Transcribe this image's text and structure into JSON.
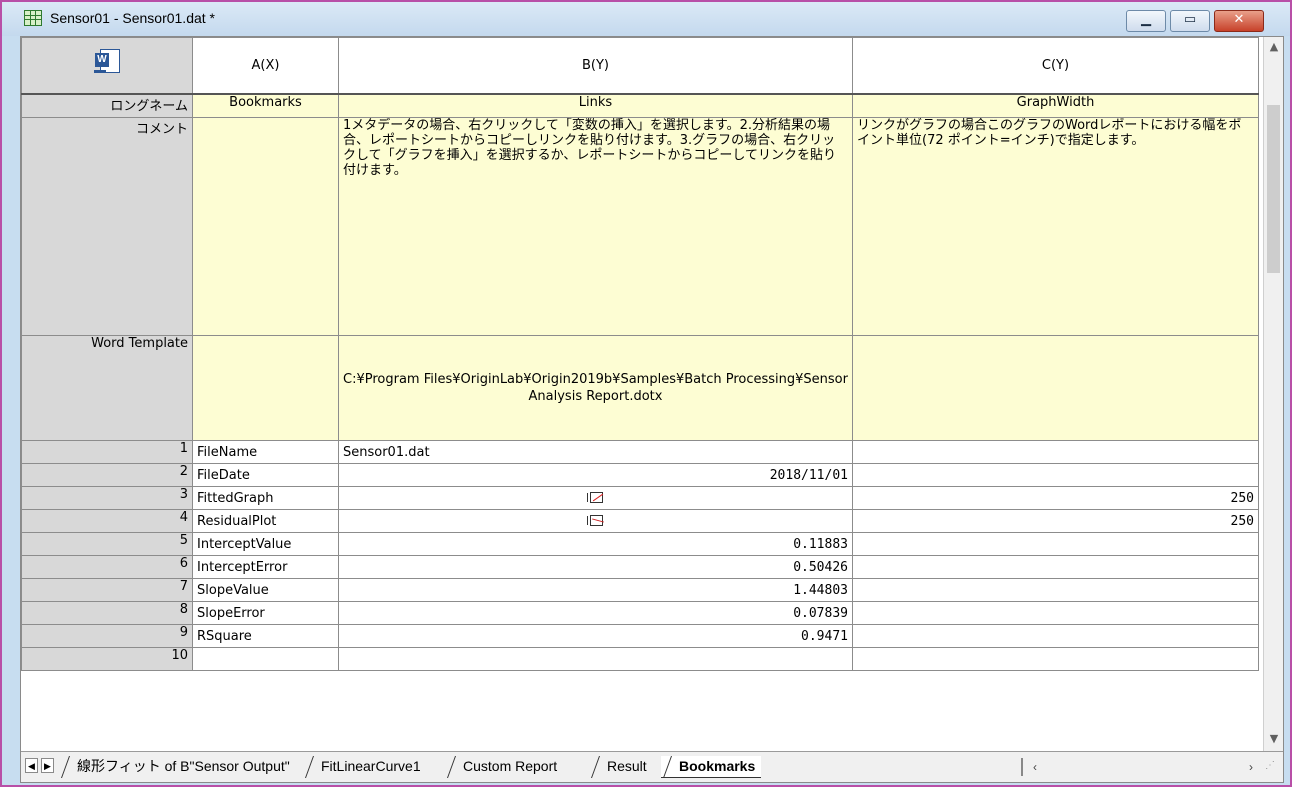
{
  "window": {
    "title": "Sensor01 - Sensor01.dat *",
    "min_glyph": "▁",
    "max_glyph": "▭",
    "close_glyph": "✕"
  },
  "columns": {
    "a": "A(X)",
    "b": "B(Y)",
    "c": "C(Y)"
  },
  "row_labels": {
    "longname": "ロングネーム",
    "comment": "コメント",
    "word_template": "Word Template"
  },
  "longname": {
    "a": "Bookmarks",
    "b": "Links",
    "c": "GraphWidth"
  },
  "comment": {
    "b": "1メタデータの場合、右クリックして「変数の挿入」を選択します。2.分析結果の場合、レポートシートからコピーしリンクを貼り付けます。3.グラフの場合、右クリックして「グラフを挿入」を選択するか、レポートシートからコピーしてリンクを貼り付けます。",
    "c": "リンクがグラフの場合このグラフのWordレポートにおける幅をポイント単位(72 ポイント=インチ)で指定します。"
  },
  "word_template": {
    "b": "C:¥Program Files¥OriginLab¥Origin2019b¥Samples¥Batch Processing¥Sensor Analysis Report.dotx"
  },
  "rows": [
    {
      "n": "1",
      "a": "FileName",
      "b": "Sensor01.dat",
      "c": ""
    },
    {
      "n": "2",
      "a": "FileDate",
      "b": "2018/11/01",
      "c": ""
    },
    {
      "n": "3",
      "a": "FittedGraph",
      "b": "",
      "c": "250"
    },
    {
      "n": "4",
      "a": "ResidualPlot",
      "b": "",
      "c": "250"
    },
    {
      "n": "5",
      "a": "InterceptValue",
      "b": "0.11883",
      "c": ""
    },
    {
      "n": "6",
      "a": "InterceptError",
      "b": "0.50426",
      "c": ""
    },
    {
      "n": "7",
      "a": "SlopeValue",
      "b": "1.44803",
      "c": ""
    },
    {
      "n": "8",
      "a": "SlopeError",
      "b": "0.07839",
      "c": ""
    },
    {
      "n": "9",
      "a": "RSquare",
      "b": "0.9471",
      "c": ""
    },
    {
      "n": "10",
      "a": "",
      "b": "",
      "c": ""
    }
  ],
  "tabs": {
    "t1": "線形フィット of B\"Sensor Output\"",
    "t2": "FitLinearCurve1",
    "t3": "Custom Report",
    "t4": "Result",
    "t5": "Bookmarks"
  },
  "icons": {
    "corner": "word-export-icon",
    "graph": "graph-thumbnail-icon",
    "residual": "residual-plot-thumbnail-icon"
  }
}
